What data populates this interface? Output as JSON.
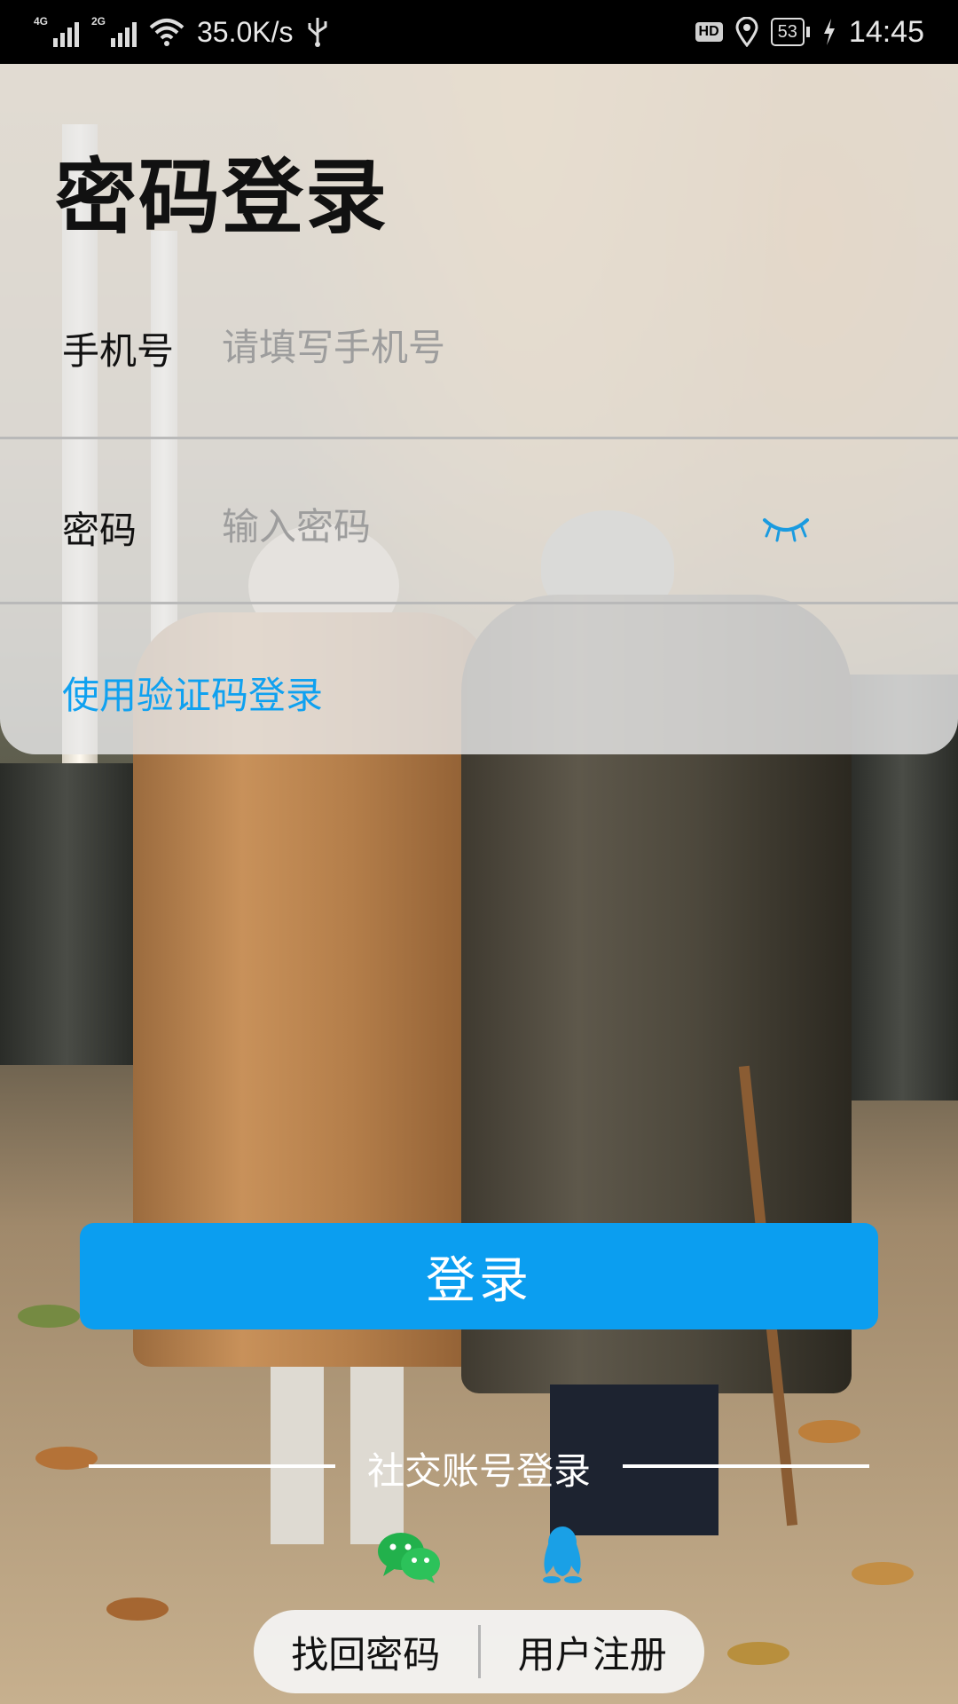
{
  "status_bar": {
    "network_1": "4G",
    "network_2": "2G",
    "speed": "35.0K/s",
    "hd": "HD",
    "battery": "53",
    "time": "14:45",
    "icons": [
      "signal-icon",
      "signal-icon",
      "wifi-icon",
      "usb-icon",
      "hd-icon",
      "location-icon",
      "battery-icon",
      "charging-icon"
    ]
  },
  "page": {
    "title": "密码登录"
  },
  "form": {
    "phone_label": "手机号",
    "phone_placeholder": "请填写手机号",
    "phone_value": "",
    "password_label": "密码",
    "password_placeholder": "输入密码",
    "password_value": "",
    "password_toggle_icon": "eye-closed-icon",
    "alt_login_link": "使用验证码登录"
  },
  "actions": {
    "login_label": "登录"
  },
  "social": {
    "title": "社交账号登录",
    "providers": [
      "wechat-icon",
      "qq-icon"
    ]
  },
  "footer": {
    "forgot_password": "找回密码",
    "register": "用户注册"
  },
  "colors": {
    "accent": "#0b9ef0",
    "link": "#0fa1f0",
    "wechat": "#22b14c",
    "qq": "#1aa0e6"
  }
}
